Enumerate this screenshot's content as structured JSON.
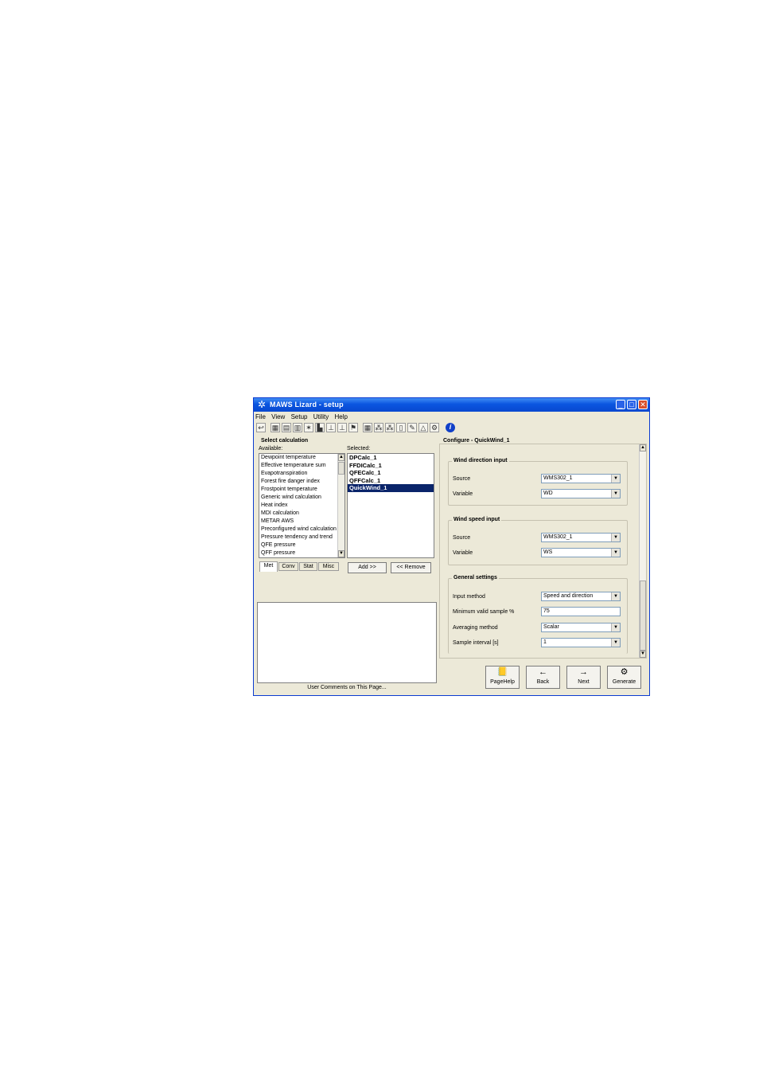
{
  "window": {
    "title": "MAWS Lizard - setup"
  },
  "menu": [
    "File",
    "View",
    "Setup",
    "Utility",
    "Help"
  ],
  "toolbar_icons": [
    "back-arrow-icon",
    "chip-icon",
    "module-icon",
    "module-icon",
    "star-icon",
    "sensor-icon",
    "antenna-icon",
    "antenna-icon",
    "flag-icon",
    "calculator-icon",
    "network-icon",
    "network-icon",
    "page-icon",
    "pen-icon",
    "bell-icon",
    "gear-icon",
    "info-icon"
  ],
  "left": {
    "section_title": "Select calculation",
    "available_label": "Available:",
    "selected_label": "Selected:",
    "available_items": [
      "Dewpoint temperature",
      "Effective temperature sum",
      "Evapotranspiration",
      "Forest fire danger index",
      "Frostpoint temperature",
      "Generic wind calculation",
      "Heat index",
      "MDI calculation",
      "METAR AWS",
      "Preconfigured wind calculation",
      "Pressure tendency and trend",
      "QFE pressure",
      "QFF pressure"
    ],
    "selected_items": [
      "DPCalc_1",
      "FFDICalc_1",
      "QFECalc_1",
      "QFFCalc_1",
      "QuickWind_1"
    ],
    "tabs": [
      "Met",
      "Conv",
      "Stat",
      "Misc"
    ],
    "add_button": "Add >>",
    "remove_button": "<< Remove",
    "comments_label": "User Comments on This Page..."
  },
  "right": {
    "title": "Configure - QuickWind_1",
    "wind_direction": {
      "title": "Wind direction input",
      "source_label": "Source",
      "source_value": "WMS302_1",
      "variable_label": "Variable",
      "variable_value": "WD"
    },
    "wind_speed": {
      "title": "Wind speed input",
      "source_label": "Source",
      "source_value": "WMS302_1",
      "variable_label": "Variable",
      "variable_value": "WS"
    },
    "general": {
      "title": "General settings",
      "input_method_label": "Input method",
      "input_method_value": "Speed and direction",
      "min_valid_label": "Minimum valid sample %",
      "min_valid_value": "75",
      "averaging_label": "Averaging method",
      "averaging_value": "Scalar",
      "sample_interval_label": "Sample interval [s]",
      "sample_interval_value": "1"
    }
  },
  "buttons": {
    "pagehelp": "PageHelp",
    "back": "Back",
    "next": "Next",
    "generate": "Generate"
  }
}
